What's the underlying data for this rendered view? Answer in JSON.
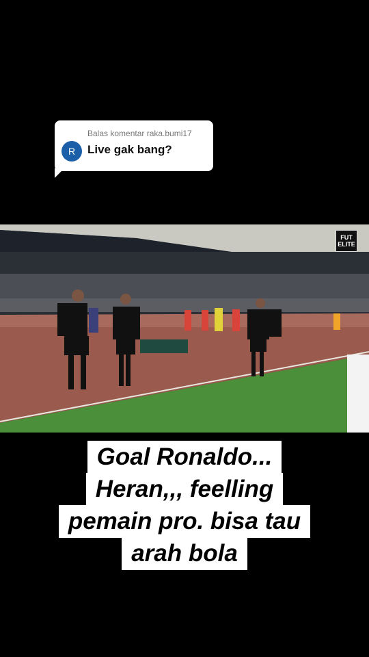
{
  "reply": {
    "header": "Balas komentar raka.bumi17",
    "avatar_letter": "R",
    "text": "Live gak bang?"
  },
  "video": {
    "watermark_line1": "FUT",
    "watermark_line2": "ELITE"
  },
  "caption": {
    "lines": [
      "Goal Ronaldo...",
      "Heran,,, feelling",
      "pemain pro. bisa tau",
      "arah bola"
    ]
  }
}
